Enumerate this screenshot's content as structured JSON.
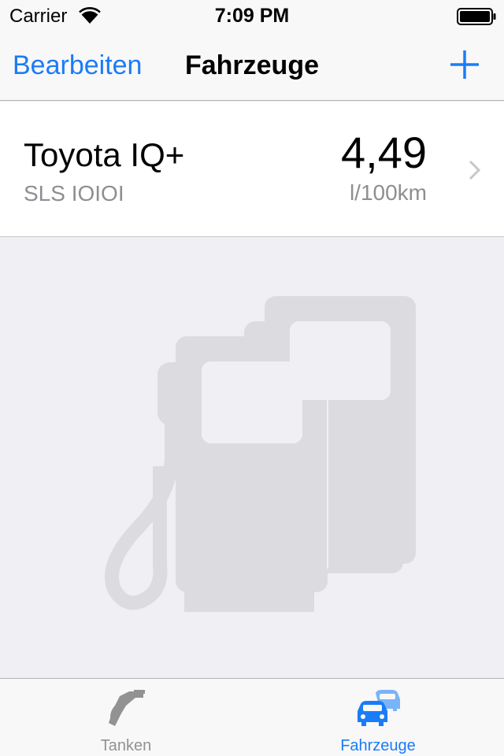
{
  "status_bar": {
    "carrier": "Carrier",
    "time": "7:09 PM",
    "wifi_icon": "wifi-icon",
    "battery_icon": "battery-icon"
  },
  "nav_bar": {
    "left_button": "Bearbeiten",
    "title": "Fahrzeuge",
    "right_icon": "plus-icon"
  },
  "vehicles": [
    {
      "name": "Toyota IQ+",
      "plate": "SLS IOIOI",
      "consumption": "4,49",
      "unit": "l/100km"
    }
  ],
  "background_icon": "fuel-pump-icon",
  "tab_bar": {
    "tabs": [
      {
        "label": "Tanken",
        "icon": "fuel-nozzle-icon",
        "selected": false
      },
      {
        "label": "Fahrzeuge",
        "icon": "cars-icon",
        "selected": true
      }
    ]
  },
  "colors": {
    "accent": "#1a7cf6",
    "background": "#efeff4",
    "bar": "#f8f8f8",
    "secondary_text": "#8e8e93",
    "illustration": "#dcdce0"
  }
}
